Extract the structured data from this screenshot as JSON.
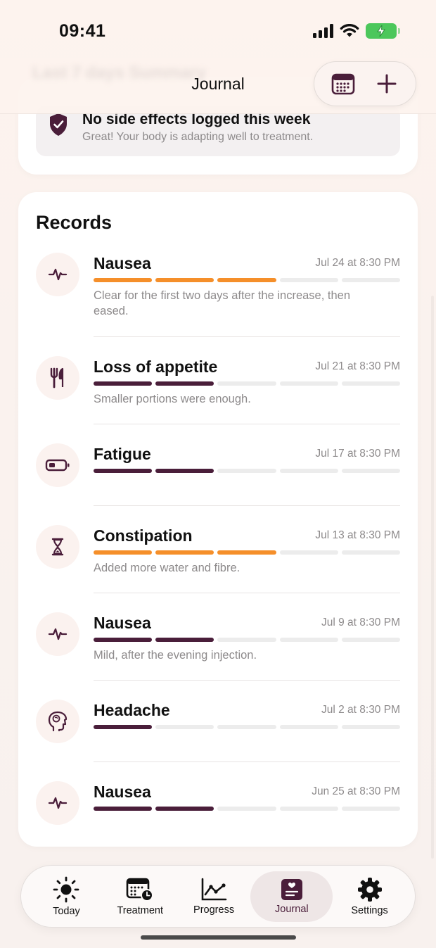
{
  "status_bar": {
    "time": "09:41"
  },
  "nav": {
    "title": "Journal",
    "ghost_title": "Last 7 days Summary"
  },
  "side_effects": {
    "title": "No side effects logged this week",
    "subtitle": "Great! Your body is adapting well to treatment."
  },
  "records": {
    "title": "Records",
    "items": [
      {
        "name": "Nausea",
        "date": "Jul 24 at 8:30 PM",
        "severity": 3,
        "color": "#f58f2a",
        "icon": "pulse-icon",
        "note": "Clear for the first two days after the increase, then eased."
      },
      {
        "name": "Loss of appetite",
        "date": "Jul 21 at 8:30 PM",
        "severity": 2,
        "color": "#4a1e3a",
        "icon": "fork-knife-icon",
        "note": "Smaller portions were enough."
      },
      {
        "name": "Fatigue",
        "date": "Jul 17 at 8:30 PM",
        "severity": 2,
        "color": "#4a1e3a",
        "icon": "battery-low-icon",
        "note": ""
      },
      {
        "name": "Constipation",
        "date": "Jul 13 at 8:30 PM",
        "severity": 3,
        "color": "#f58f2a",
        "icon": "hourglass-icon",
        "note": "Added more water and fibre."
      },
      {
        "name": "Nausea",
        "date": "Jul 9 at 8:30 PM",
        "severity": 2,
        "color": "#4a1e3a",
        "icon": "pulse-icon",
        "note": "Mild, after the evening injection."
      },
      {
        "name": "Headache",
        "date": "Jul 2 at 8:30 PM",
        "severity": 1,
        "color": "#4a1e3a",
        "icon": "head-icon",
        "note": ""
      },
      {
        "name": "Nausea",
        "date": "Jun 25 at 8:30 PM",
        "severity": 2,
        "color": "#4a1e3a",
        "icon": "pulse-icon",
        "note": ""
      }
    ]
  },
  "tabs": [
    {
      "label": "Today",
      "icon": "sun-icon",
      "active": false
    },
    {
      "label": "Treatment",
      "icon": "calendar-clock-icon",
      "active": false
    },
    {
      "label": "Progress",
      "icon": "chart-line-icon",
      "active": false
    },
    {
      "label": "Journal",
      "icon": "journal-icon",
      "active": true
    },
    {
      "label": "Settings",
      "icon": "gear-icon",
      "active": false
    }
  ],
  "colors": {
    "accent": "#4a1e3a",
    "warning": "#f58f2a",
    "battery": "#4cc75b"
  }
}
